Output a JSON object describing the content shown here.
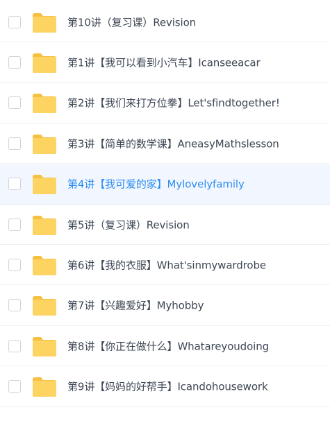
{
  "files": [
    {
      "name": "第10讲（复习课）Revision",
      "selected": false
    },
    {
      "name": "第1讲【我可以看到小汽车】Icanseeacar",
      "selected": false
    },
    {
      "name": "第2讲【我们来打方位拳】Let'sfindtogether!",
      "selected": false
    },
    {
      "name": "第3讲【简单的数学课】AneasyMathslesson",
      "selected": false
    },
    {
      "name": "第4讲【我可爱的家】Mylovelyfamily",
      "selected": true
    },
    {
      "name": "第5讲（复习课）Revision",
      "selected": false
    },
    {
      "name": "第6讲【我的衣服】What'sinmywardrobe",
      "selected": false
    },
    {
      "name": "第7讲【兴趣爱好】Myhobby",
      "selected": false
    },
    {
      "name": "第8讲【你正在做什么】Whatareyoudoing",
      "selected": false
    },
    {
      "name": "第9讲【妈妈的好帮手】Icandohousework",
      "selected": false
    }
  ],
  "colors": {
    "folder": "#fdd361",
    "folder_tab": "#f6c043",
    "highlight_text": "#2d8cf0",
    "highlight_bg": "#f2f7ff",
    "text": "#3d4654"
  },
  "icons": {
    "folder": "folder-icon",
    "checkbox": "checkbox"
  }
}
